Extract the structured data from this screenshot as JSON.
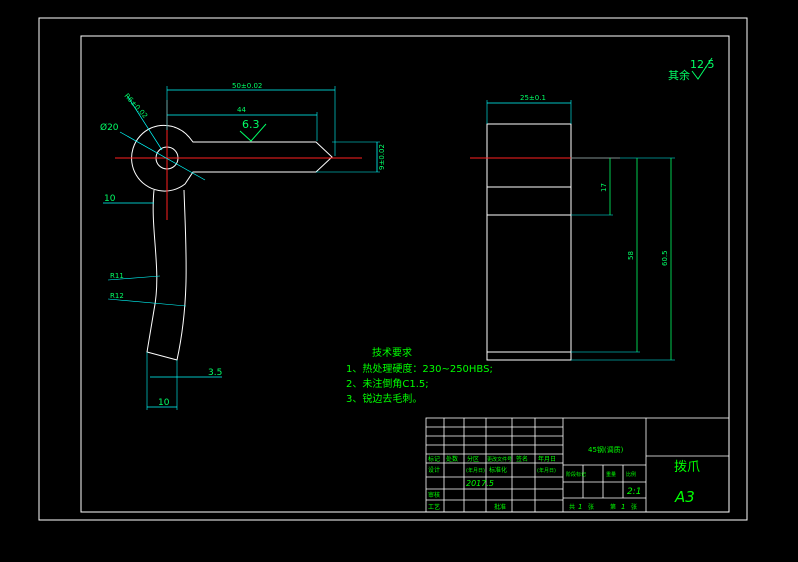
{
  "dimensions": {
    "total_length": "50±0.02",
    "slot_length": "44",
    "roughness_63": "6.3",
    "bore_diameter": "Ø20",
    "small_radius": "R6±0.02",
    "right_width": "9±0.02",
    "offset_10_top": "10",
    "arc_r1": "R11",
    "arc_r2": "R12",
    "tip_3_5": "3.5",
    "bottom_10": "10",
    "side_width": "25±0.1",
    "side_17": "17",
    "side_58": "58",
    "side_60_5": "60.5"
  },
  "roughness_note": {
    "label": "其余",
    "value": "12.5"
  },
  "technical_requirements": {
    "title": "技术要求",
    "items": [
      "1、热处理硬度：230~250HBS;",
      "2、未注倒角C1.5;",
      "3、锐边去毛刺。"
    ]
  },
  "title_block": {
    "upper_row_labels": [
      "标记",
      "处数",
      "分区",
      "更改文件号",
      "签名",
      "年月日"
    ],
    "design_label": "设计",
    "design_date_hdr": "(年月日)",
    "standard_label": "标准化",
    "standard_date_hdr": "(年月日)",
    "date_value": "2017.5",
    "review_label": "审核",
    "process_label": "工艺",
    "approve_label": "批准",
    "material_mark": "45钢(调质)",
    "stage_labels": [
      "阶段标记",
      "重量",
      "比例"
    ],
    "scale": "2:1",
    "sheet_info": [
      "共",
      "张",
      "第",
      "张"
    ],
    "sheet_num_total": "1",
    "sheet_num_current": "1",
    "part_name": "拨爪",
    "sheet_size": "A3"
  }
}
